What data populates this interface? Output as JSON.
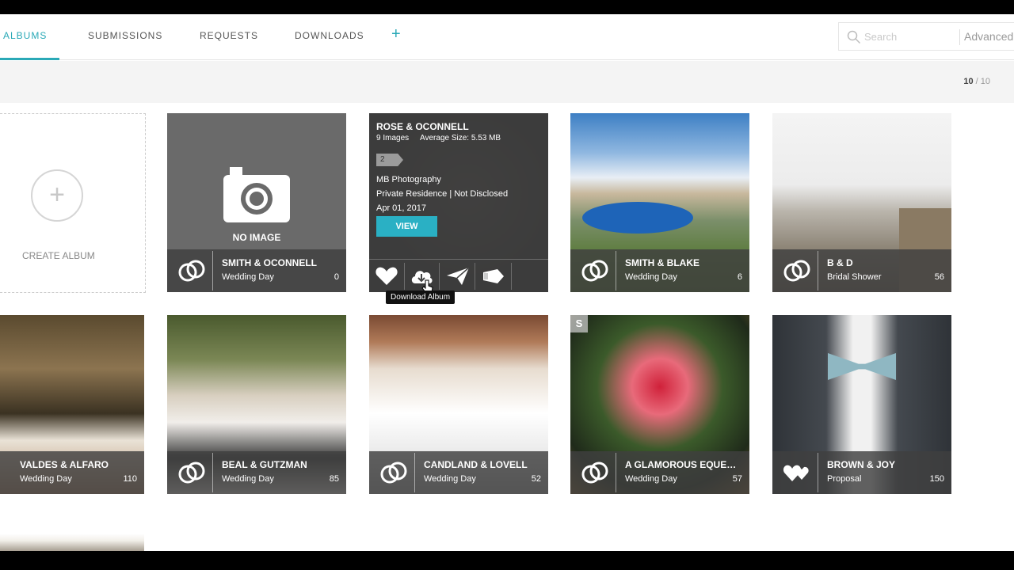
{
  "nav": {
    "tabs": [
      {
        "label": "ALBUMS"
      },
      {
        "label": "SUBMISSIONS"
      },
      {
        "label": "REQUESTS"
      },
      {
        "label": "DOWNLOADS"
      }
    ],
    "add_label": "+",
    "search_placeholder": "Search",
    "advanced_label": "Advanced"
  },
  "count": {
    "current": "10",
    "total": "/ 10"
  },
  "create_album": {
    "icon": "+",
    "label": "CREATE ALBUM"
  },
  "albums": [
    {
      "title": "SMITH & OCONNELL",
      "type": "Wedding Day",
      "count": "0",
      "no_image_label": "NO IMAGE"
    },
    {
      "title": "ROSE & OCONNELL",
      "images": "9 Images",
      "avg_size": "Average Size: 5.53 MB",
      "tag": "2",
      "photographer": "MB Photography",
      "location": "Private Residence | Not Disclosed",
      "date": "Apr 01, 2017",
      "view_label": "VIEW",
      "tooltip": "Download Album"
    },
    {
      "title": "SMITH & BLAKE",
      "type": "Wedding Day",
      "count": "6"
    },
    {
      "title": "B & D",
      "type": "Bridal Shower",
      "count": "56"
    },
    {
      "title": "VALDES & ALFARO",
      "type": "Wedding Day",
      "count": "110"
    },
    {
      "title": "BEAL & GUTZMAN",
      "type": "Wedding Day",
      "count": "85"
    },
    {
      "title": "CANDLAND & LOVELL",
      "type": "Wedding Day",
      "count": "52"
    },
    {
      "title": "A GLAMOROUS EQUESTRIAN",
      "type": "Wedding Day",
      "count": "57",
      "badge": "S"
    },
    {
      "title": "BROWN & JOY",
      "type": "Proposal",
      "count": "150"
    }
  ],
  "colors": {
    "accent": "#2aa9b7",
    "view_button": "#2ab0c4"
  }
}
